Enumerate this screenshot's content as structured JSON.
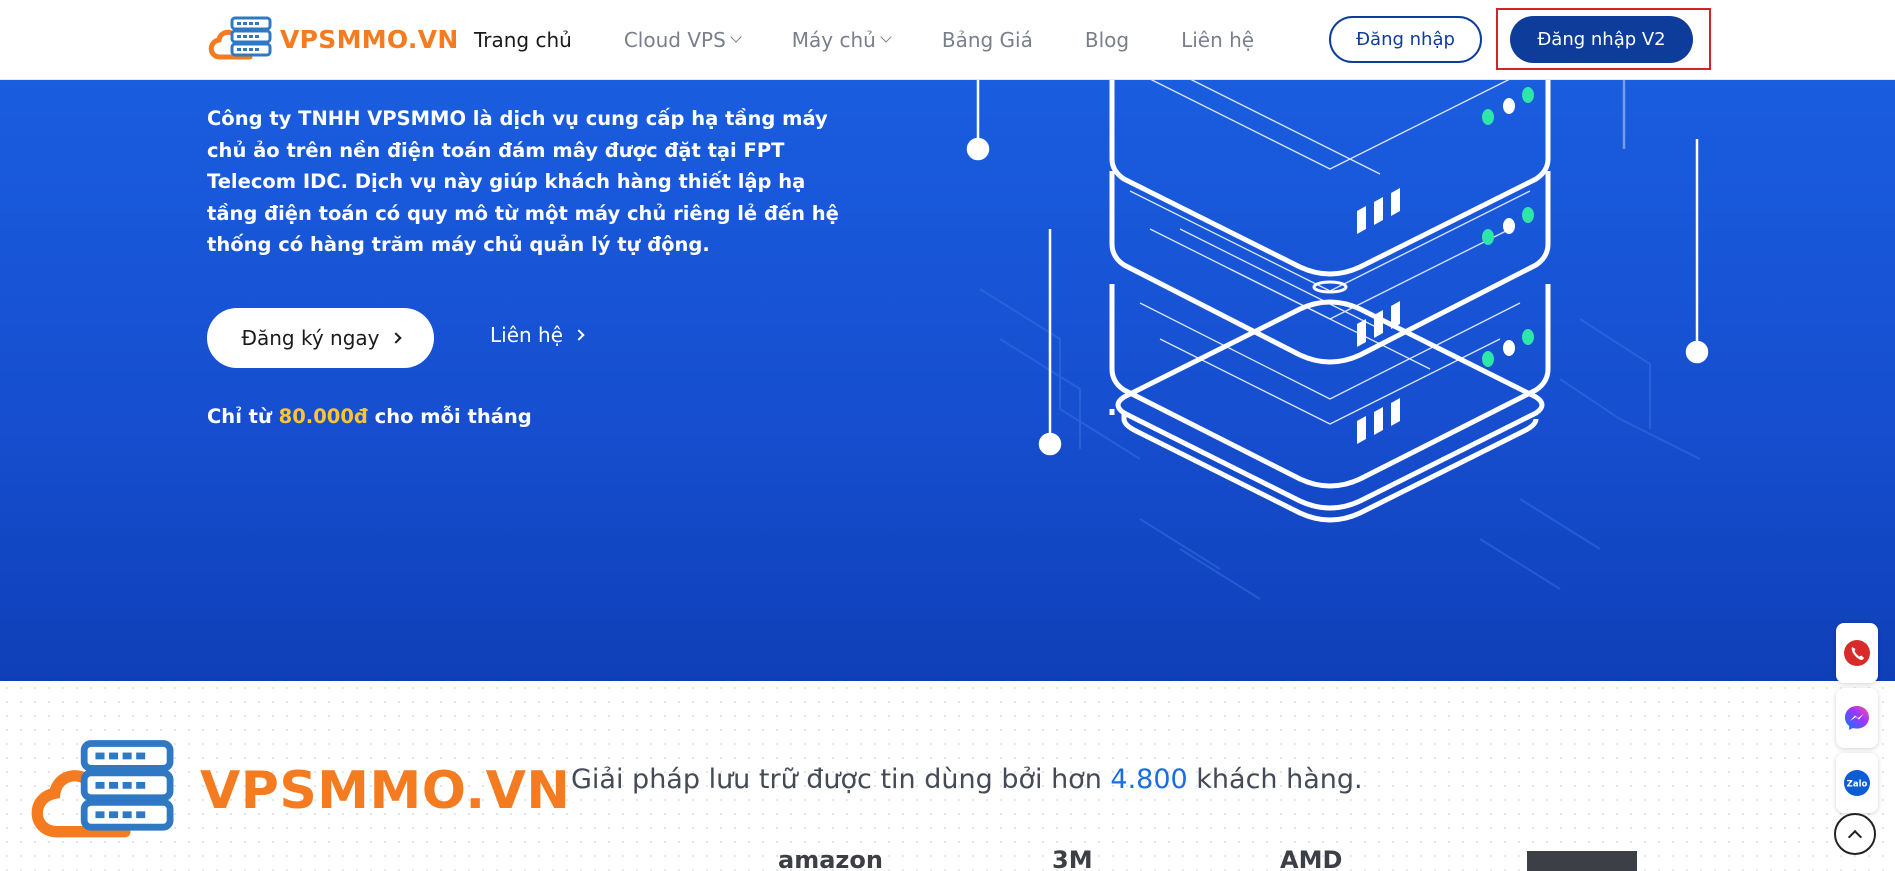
{
  "header": {
    "logo_text": "VPSMMO.VN",
    "nav": [
      {
        "label": "Trang chủ",
        "active": true
      },
      {
        "label": "Cloud VPS",
        "dropdown": true
      },
      {
        "label": "Máy chủ",
        "dropdown": true
      },
      {
        "label": "Bảng Giá"
      },
      {
        "label": "Blog"
      },
      {
        "label": "Liên hệ"
      }
    ],
    "login_label": "Đăng nhập",
    "login_v2_label": "Đăng nhập V2"
  },
  "hero": {
    "description": "Công ty TNHH VPSMMO là dịch vụ cung cấp hạ tầng máy chủ ảo trên nền điện toán đám mây được đặt tại FPT Telecom IDC. Dịch vụ này giúp khách hàng thiết lập hạ tầng điện toán có quy mô từ một máy chủ riêng lẻ đến hệ thống có hàng trăm máy chủ quản lý tự động.",
    "register_label": "Đăng ký ngay",
    "contact_label": "Liên hệ",
    "price_prefix": "Chỉ từ ",
    "price_value": "80.000đ",
    "price_suffix": " cho mỗi tháng"
  },
  "trust": {
    "logo_text": "VPSMMO.VN",
    "prefix": "Giải pháp lưu trữ được tin dùng bởi hơn ",
    "count": "4.800",
    "suffix": " khách hàng."
  },
  "partners": [
    "amazon",
    "3M",
    "AMD"
  ],
  "floating": [
    "phone-icon",
    "messenger-icon",
    "zalo-icon"
  ],
  "floating_zalo_label": "Zalo",
  "colors": {
    "brand_orange": "#f47b20",
    "primary_blue": "#0d3c9b",
    "hero_blue": "#1a5ddf",
    "price_yellow": "#ffc531",
    "highlight_red": "#d6202a"
  }
}
